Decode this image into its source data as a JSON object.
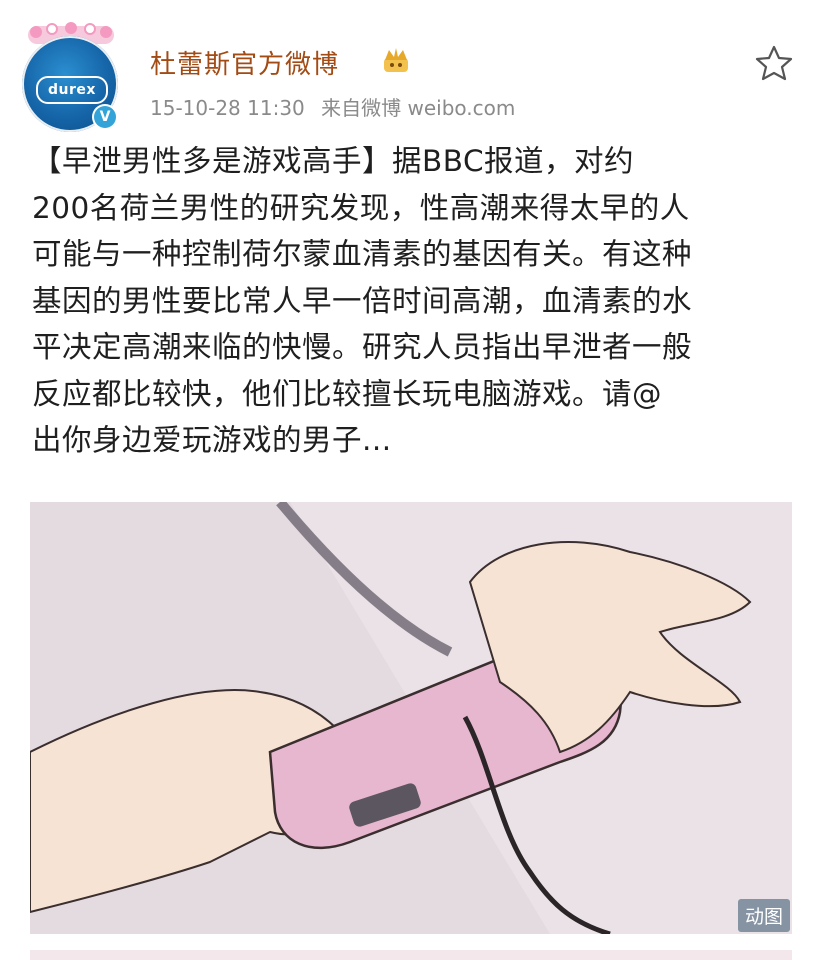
{
  "post": {
    "author": {
      "name": "杜蕾斯官方微博",
      "avatar_text": "durex",
      "verified_mark": "V",
      "vip_icon": "crown-icon"
    },
    "meta": {
      "time": "15-10-28 11:30",
      "source": "来自微博 weibo.com"
    },
    "text_lines": [
      "【早泄男性多是游戏高手】据BBC报道，对约",
      "200名荷兰男性的研究发现，性高潮来得太早的人",
      "可能与一种控制荷尔蒙血清素的基因有关。有这种",
      "基因的男性要比常人早一倍时间高潮，血清素的水",
      "平决定高潮来临的快慢。研究人员指出早泄者一般",
      "反应都比较快，他们比较擅长玩电脑游戏。请@",
      "出你身边爱玩游戏的男子..."
    ],
    "media": {
      "badge": "动图"
    }
  },
  "colors": {
    "author_name": "#a24b14",
    "meta_text": "#8a8a8a",
    "verified": "#34a4d8",
    "avatar_blue": "#1565a8"
  }
}
